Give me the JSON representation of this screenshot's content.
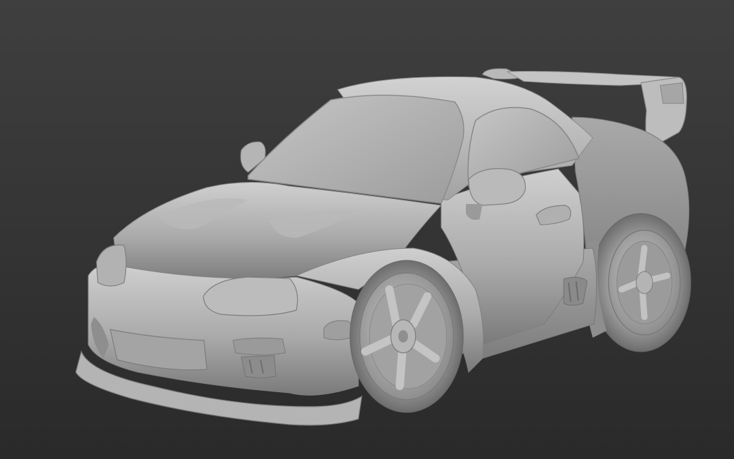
{
  "viewport": {
    "background_top": "#3f3f3f",
    "background_bottom": "#2a2a2a",
    "model_base_color": "#a8a8a8",
    "model_highlight_color": "#d6d6d6",
    "model_shadow_color": "#6a6a6a",
    "shading": "clay"
  },
  "model": {
    "icon": "car-3d-model"
  }
}
